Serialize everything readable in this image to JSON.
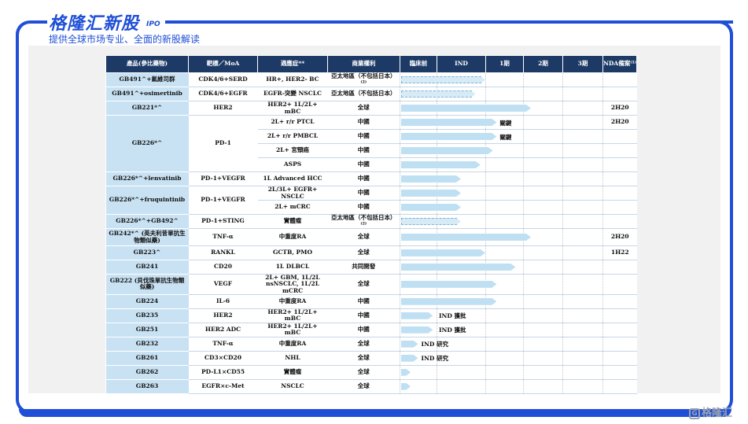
{
  "brand": {
    "title": "格隆汇新股",
    "ipo": "IPO",
    "subtitle": "提供全球市场专业、全面的新股解读"
  },
  "table": {
    "headers": [
      "產品(參比藥物)",
      "靶標／MoA",
      "適應症**",
      "商業權利",
      "臨床前",
      "IND",
      "1期",
      "2期",
      "3期",
      "NDA備案⁽¹⁾"
    ],
    "rows": [
      {
        "product": "GB491^+氟維司群",
        "target": "CDK4/6+SERD",
        "indication": "HR+, HER2- BC",
        "rights": "亞太地區（不包括日本）⁽²⁾",
        "stage": 2.0,
        "dashed": true,
        "note": "",
        "nda": ""
      },
      {
        "product": "GB491^+osimertinib",
        "target": "CDK4/6+EGFR",
        "indication": "EGFR-突變 NSCLC",
        "rights": "亞太地區（不包括日本）",
        "stage": 1.8,
        "dashed": true,
        "note": "",
        "nda": ""
      },
      {
        "product": "GB221*^",
        "target": "HER2",
        "indication": "HER2+ 1L/2L+ mBC",
        "rights": "全球",
        "stage": 3.2,
        "dashed": false,
        "note": "",
        "nda": "2H20"
      },
      {
        "product": "GB226*^",
        "target": "PD-1",
        "indication": "2L+ r/r PTCL",
        "rights": "中國",
        "stage": 2.3,
        "dashed": false,
        "note": "關鍵",
        "nda": "2H20"
      },
      {
        "product": "",
        "target": "",
        "indication": "2L+ r/r PMBCL",
        "rights": "中國",
        "stage": 2.3,
        "dashed": false,
        "note": "關鍵",
        "nda": ""
      },
      {
        "product": "",
        "target": "",
        "indication": "2L+ 宮頸癌",
        "rights": "中國",
        "stage": 2.2,
        "dashed": false,
        "note": "",
        "nda": ""
      },
      {
        "product": "",
        "target": "",
        "indication": "ASPS",
        "rights": "中國",
        "stage": 1.9,
        "dashed": false,
        "note": "",
        "nda": ""
      },
      {
        "product": "GB226*^+lenvatinib",
        "target": "PD-1+VEGFR",
        "indication": "1L Advanced HCC",
        "rights": "中國",
        "stage": 1.5,
        "dashed": false,
        "note": "",
        "nda": ""
      },
      {
        "product": "GB226*^+fruquintinib",
        "target": "PD-1+VEGFR",
        "indication": "2L/3L+ EGFR+ NSCLC",
        "rights": "中國",
        "stage": 1.5,
        "dashed": false,
        "note": "",
        "nda": ""
      },
      {
        "product": "",
        "target": "",
        "indication": "2L+ mCRC",
        "rights": "中國",
        "stage": 1.5,
        "dashed": false,
        "note": "",
        "nda": ""
      },
      {
        "product": "GB226*^+GB492^",
        "target": "PD-1+STING",
        "indication": "實體瘤",
        "rights": "亞太地區（不包括日本）⁽²⁾",
        "stage": 1.5,
        "dashed": true,
        "note": "",
        "nda": ""
      },
      {
        "product": "GB242*^ (英夫利昔單抗生物類似藥)",
        "target": "TNF-α",
        "indication": "中重度RA",
        "rights": "全球",
        "stage": 3.2,
        "dashed": false,
        "note": "",
        "nda": "2H20"
      },
      {
        "product": "GB223^",
        "target": "RANKL",
        "indication": "GCTB, PMO",
        "rights": "全球",
        "stage": 2.0,
        "dashed": false,
        "note": "",
        "nda": "1H22"
      },
      {
        "product": "GB241",
        "target": "CD20",
        "indication": "1L DLBCL",
        "rights": "共同開發",
        "stage": 2.8,
        "dashed": false,
        "note": "",
        "nda": ""
      },
      {
        "product": "GB222 (貝伐珠單抗生物類似藥)",
        "target": "VEGF",
        "indication": "2L+ GBM, 1L/2L nsNSCLC, 1L/2L mCRC",
        "rights": "全球",
        "stage": 2.3,
        "dashed": false,
        "note": "",
        "nda": ""
      },
      {
        "product": "GB224",
        "target": "IL-6",
        "indication": "中重度RA",
        "rights": "中國",
        "stage": 2.3,
        "dashed": false,
        "note": "",
        "nda": ""
      },
      {
        "product": "GB235",
        "target": "HER2",
        "indication": "HER2+ 1L/2L+ mBC",
        "rights": "中國",
        "stage": 0.9,
        "dashed": false,
        "note": "IND 獲批",
        "nda": ""
      },
      {
        "product": "GB251",
        "target": "HER2 ADC",
        "indication": "HER2+ 1L/2L+ mBC",
        "rights": "中國",
        "stage": 0.9,
        "dashed": false,
        "note": "IND 獲批",
        "nda": ""
      },
      {
        "product": "GB232",
        "target": "TNF-α",
        "indication": "中重度RA",
        "rights": "全球",
        "stage": 0.5,
        "dashed": false,
        "note": "IND 研究",
        "nda": ""
      },
      {
        "product": "GB261",
        "target": "CD3×CD20",
        "indication": "NHL",
        "rights": "全球",
        "stage": 0.5,
        "dashed": false,
        "note": "IND 研究",
        "nda": ""
      },
      {
        "product": "GB262",
        "target": "PD-L1×CD55",
        "indication": "實體瘤",
        "rights": "全球",
        "stage": 0.3,
        "dashed": false,
        "note": "",
        "nda": ""
      },
      {
        "product": "GB263",
        "target": "EGFR×c-Met",
        "indication": "NSCLC",
        "rights": "全球",
        "stage": 0.3,
        "dashed": false,
        "note": "",
        "nda": ""
      }
    ]
  },
  "colors": {
    "brand_blue": "#1f4fd6",
    "header_navy": "#1d3a66",
    "product_cell": "#c9e2f3",
    "bar": "#bfe0f2"
  },
  "watermark": "格隆汇"
}
